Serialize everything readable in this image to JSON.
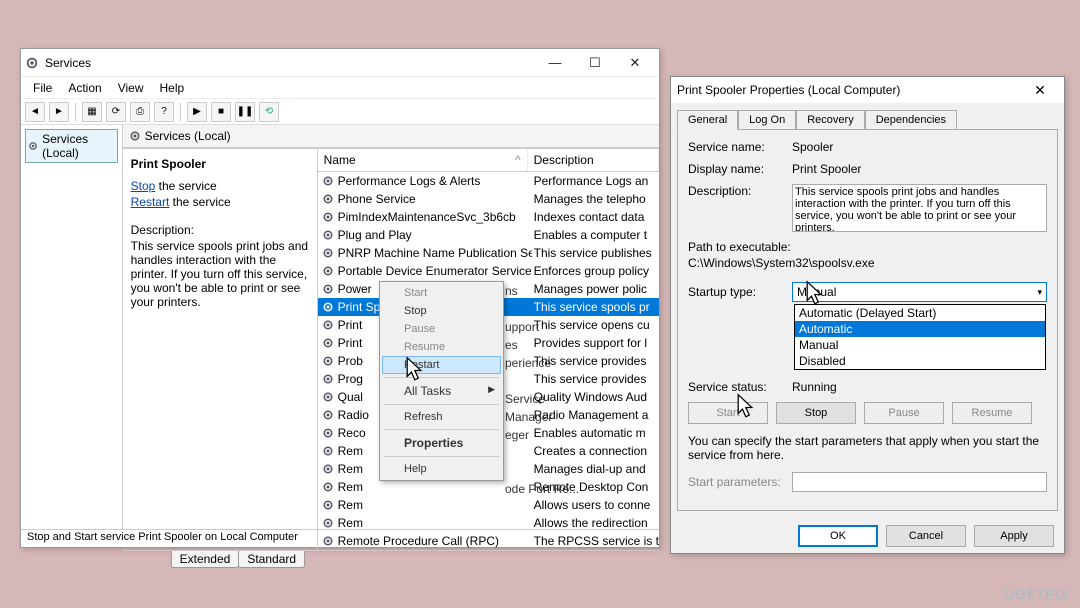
{
  "services_window": {
    "title": "Services",
    "menu": {
      "file": "File",
      "action": "Action",
      "view": "View",
      "help": "Help"
    },
    "tree_root": "Services (Local)",
    "content_header": "Services (Local)",
    "desc_title": "Print Spooler",
    "link_stop": "Stop",
    "link_restart": "Restart",
    "link_suffix": " the service",
    "desc_label": "Description:",
    "desc_text": "This service spools print jobs and handles interaction with the printer. If you turn off this service, you won't be able to print or see your printers.",
    "col_name": "Name",
    "col_desc": "Description",
    "services": [
      {
        "name": "Performance Logs & Alerts",
        "desc": "Performance Logs an"
      },
      {
        "name": "Phone Service",
        "desc": "Manages the telepho"
      },
      {
        "name": "PimIndexMaintenanceSvc_3b6cb",
        "desc": "Indexes contact data"
      },
      {
        "name": "Plug and Play",
        "desc": "Enables a computer t"
      },
      {
        "name": "PNRP Machine Name Publication Service",
        "desc": "This service publishes"
      },
      {
        "name": "Portable Device Enumerator Service",
        "desc": "Enforces group policy"
      },
      {
        "name": "Power",
        "desc": "Manages power polic"
      },
      {
        "name": "Print Spooler",
        "desc": "This service spools pr",
        "selected": true
      },
      {
        "name": "Print",
        "desc": "This service opens cu"
      },
      {
        "name": "Print",
        "desc": "Provides support for l"
      },
      {
        "name": "Prob",
        "desc": "This service provides"
      },
      {
        "name": "Prog",
        "desc": "This service provides"
      },
      {
        "name": "Qual",
        "desc": "Quality Windows Aud"
      },
      {
        "name": "Radio",
        "desc": "Radio Management a"
      },
      {
        "name": "Reco",
        "desc": "Enables automatic m"
      },
      {
        "name": "Rem",
        "desc": "Creates a connection"
      },
      {
        "name": "Rem",
        "desc": "Manages dial-up and"
      },
      {
        "name": "Rem",
        "desc": "Remote Desktop Con"
      },
      {
        "name": "Rem",
        "desc": "Allows users to conne"
      },
      {
        "name": "Rem",
        "desc": "Allows the redirection"
      },
      {
        "name": "Remote Procedure Call (RPC)",
        "desc": "The RPCSS service is t"
      }
    ],
    "ctx": {
      "start": "Start",
      "stop": "Stop",
      "pause": "Pause",
      "resume": "Resume",
      "restart": "Restart",
      "all_tasks": "All Tasks",
      "refresh": "Refresh",
      "properties": "Properties",
      "help": "Help",
      "trunc_ns": "ns",
      "trunc_support": "upport",
      "trunc_es": "es",
      "trunc_perience": "perience",
      "trunc_service": "Service",
      "trunc_manager": "Manager",
      "trunc_eger": "eger",
      "trunc_ode": "ode Port Re..."
    },
    "tab_extended": "Extended",
    "tab_standard": "Standard",
    "status": "Stop and Start service Print Spooler on Local Computer"
  },
  "props": {
    "title": "Print Spooler Properties (Local Computer)",
    "tabs": {
      "general": "General",
      "logon": "Log On",
      "recovery": "Recovery",
      "deps": "Dependencies"
    },
    "svc_name_lab": "Service name:",
    "svc_name": "Spooler",
    "disp_name_lab": "Display name:",
    "disp_name": "Print Spooler",
    "desc_lab": "Description:",
    "desc": "This service spools print jobs and handles interaction with the printer. If you turn off this service, you won't be able to print or see your printers.",
    "path_lab": "Path to executable:",
    "path": "C:\\Windows\\System32\\spoolsv.exe",
    "startup_lab": "Startup type:",
    "startup_val": "Manual",
    "options": {
      "delayed": "Automatic (Delayed Start)",
      "auto": "Automatic",
      "manual": "Manual",
      "disabled": "Disabled"
    },
    "status_lab": "Service status:",
    "status_val": "Running",
    "btn_start": "Start",
    "btn_stop": "Stop",
    "btn_pause": "Pause",
    "btn_resume": "Resume",
    "hint": "You can specify the start parameters that apply when you start the service from here.",
    "params_lab": "Start parameters:",
    "ok": "OK",
    "cancel": "Cancel",
    "apply": "Apply"
  },
  "watermark": "UG€TFIX"
}
